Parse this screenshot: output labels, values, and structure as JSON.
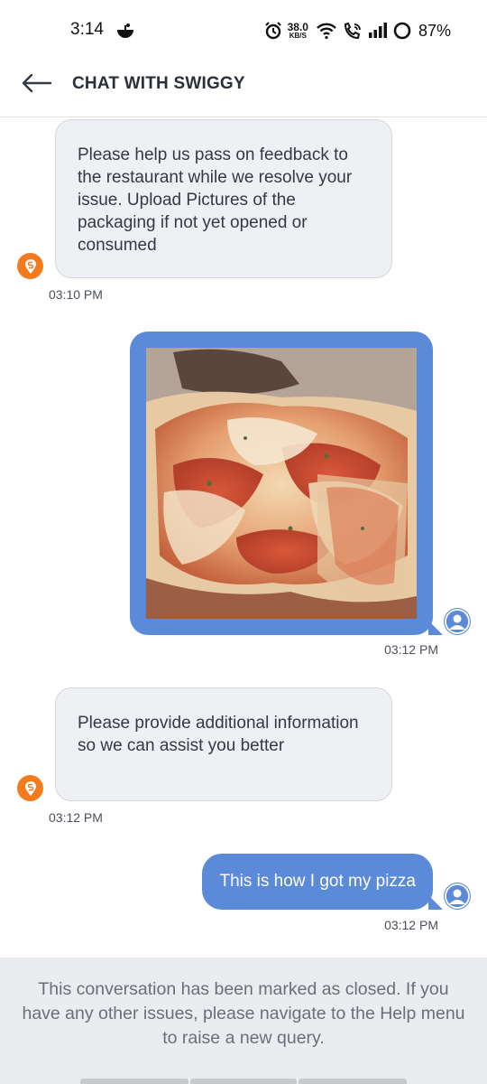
{
  "status_bar": {
    "time": "3:14",
    "speed_value": "38.0",
    "speed_unit": "KB/S",
    "battery": "87%"
  },
  "header": {
    "title": "CHAT WITH SWIGGY"
  },
  "messages": [
    {
      "sender": "bot",
      "text": "Please help us pass on feedback to the restaurant while we resolve your issue. Upload Pictures of the packaging if not yet opened or consumed",
      "time": "03:10 PM"
    },
    {
      "sender": "user",
      "type": "image",
      "image_icon": "pizza-photo",
      "time": "03:12 PM"
    },
    {
      "sender": "bot",
      "text": "Please provide additional information so we can assist you better",
      "time": "03:12 PM"
    },
    {
      "sender": "user",
      "text": "This is how I got my pizza",
      "time": "03:12 PM"
    }
  ],
  "footer": {
    "text": "This conversation has been marked as closed. If you have any other issues, please navigate to the Help menu to raise a new query."
  },
  "colors": {
    "user_bubble": "#5b8ad8",
    "bot_avatar": "#f47a1e",
    "bot_bubble": "#eef0f3"
  }
}
